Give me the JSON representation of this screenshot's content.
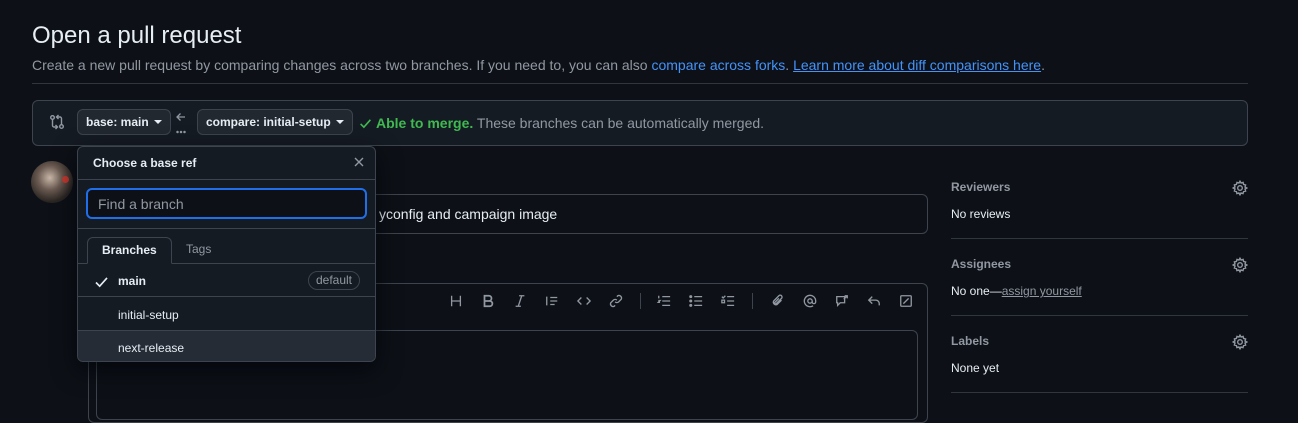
{
  "page": {
    "title": "Open a pull request",
    "subtitle_text": "Create a new pull request by comparing changes across two branches. If you need to, you can also ",
    "subtitle_link1": "compare across forks",
    "subtitle_sep": ". ",
    "subtitle_link2": "Learn more about diff comparisons here",
    "subtitle_end": "."
  },
  "range": {
    "base_label": "base: main",
    "compare_label": "compare: initial-setup",
    "merge_ok": "Able to merge.",
    "merge_rest": " These branches can be automatically merged."
  },
  "form": {
    "title_value": "yconfig and campaign image"
  },
  "sidebar": {
    "reviewers_label": "Reviewers",
    "reviewers_value": "No reviews",
    "assignees_label": "Assignees",
    "assignees_value": "No one—",
    "assign_yourself": "assign yourself",
    "labels_label": "Labels",
    "labels_value": "None yet"
  },
  "popover": {
    "title": "Choose a base ref",
    "filter_placeholder": "Find a branch",
    "tab_branches": "Branches",
    "tab_tags": "Tags",
    "items": [
      {
        "name": "main",
        "selected": true,
        "badge": "default"
      },
      {
        "name": "initial-setup",
        "selected": false,
        "badge": ""
      },
      {
        "name": "next-release",
        "selected": false,
        "badge": ""
      }
    ]
  },
  "colors": {
    "background": "#0d1117",
    "accent_link": "#4493f8",
    "success": "#3fb950",
    "focus_border": "#1f6feb"
  }
}
